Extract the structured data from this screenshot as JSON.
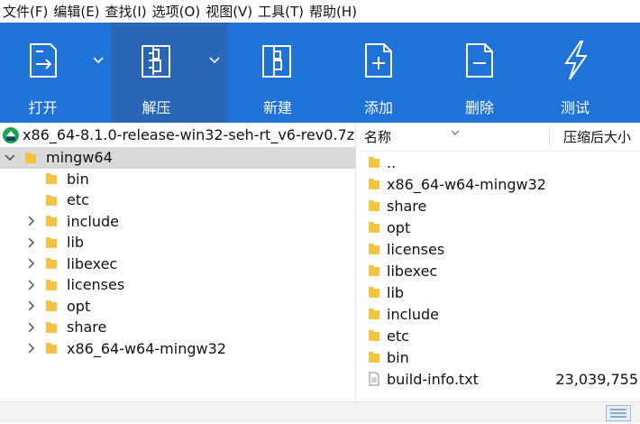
{
  "menu": [
    "文件(F)",
    "编辑(E)",
    "查找(I)",
    "选项(O)",
    "视图(V)",
    "工具(T)",
    "帮助(H)"
  ],
  "toolbar": {
    "open": "打开",
    "extract": "解压",
    "new": "新建",
    "add": "添加",
    "delete": "删除",
    "test": "测试"
  },
  "tree": {
    "root": "x86_64-8.1.0-release-win32-seh-rt_v6-rev0.7z",
    "selected": "mingw64",
    "children": [
      "bin",
      "etc",
      "include",
      "lib",
      "libexec",
      "licenses",
      "opt",
      "share",
      "x86_64-w64-mingw32"
    ]
  },
  "list": {
    "headers": {
      "name": "名称",
      "size": "压缩后大小"
    },
    "items": [
      {
        "name": "..",
        "size": ""
      },
      {
        "name": "x86_64-w64-mingw32",
        "size": ""
      },
      {
        "name": "share",
        "size": ""
      },
      {
        "name": "opt",
        "size": ""
      },
      {
        "name": "licenses",
        "size": ""
      },
      {
        "name": "libexec",
        "size": ""
      },
      {
        "name": "lib",
        "size": ""
      },
      {
        "name": "include",
        "size": ""
      },
      {
        "name": "etc",
        "size": ""
      },
      {
        "name": "bin",
        "size": ""
      },
      {
        "name": "build-info.txt",
        "size": "23,039,755"
      }
    ]
  },
  "colors": {
    "toolbar": "#1f72d8",
    "toolbar_dark": "#2a66b7",
    "folder": "#f5c342",
    "selected": "#d9d9d9"
  }
}
